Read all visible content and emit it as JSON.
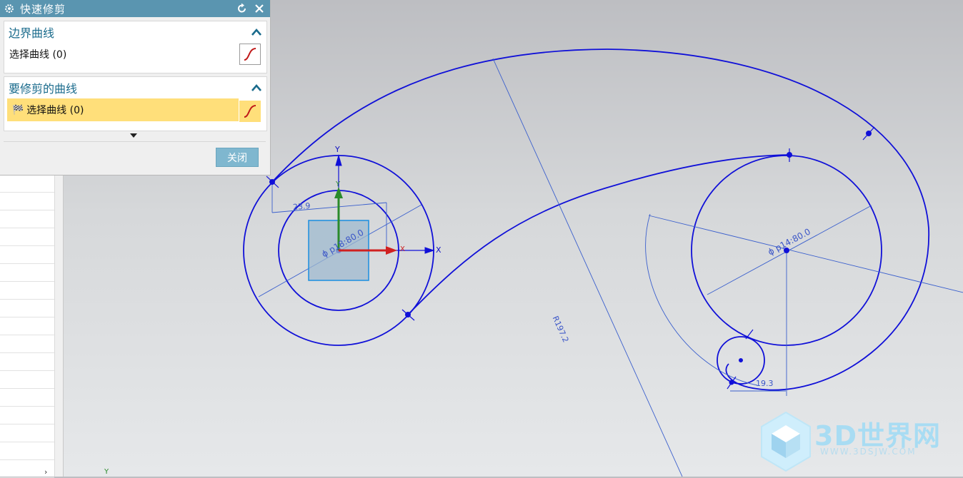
{
  "dialog": {
    "title": "快速修剪",
    "groups": [
      {
        "header": "边界曲线",
        "select_label": "选择曲线 (0)"
      },
      {
        "header": "要修剪的曲线",
        "select_label": "选择曲线 (0)"
      }
    ],
    "close_label": "关闭"
  },
  "viewport": {
    "csys_axes": {
      "y": "Y",
      "x": "X",
      "y_green": "Y",
      "x_red": "X",
      "corner_y": "Y"
    },
    "dimensions": {
      "offset": "23.9",
      "dia_small": "ϕ p18:80.0",
      "dia_right": "ϕ p14:80.0",
      "radius": "R197.2",
      "small_offset": "19.3"
    }
  },
  "watermark": {
    "title": "3D世界网",
    "subtitle": "WWW.3DSJW.COM"
  },
  "colors": {
    "curve": "#1010d8",
    "dimension": "#3a5fcd",
    "titlebar": "#5a95b0",
    "active_row": "#ffdf7a"
  }
}
